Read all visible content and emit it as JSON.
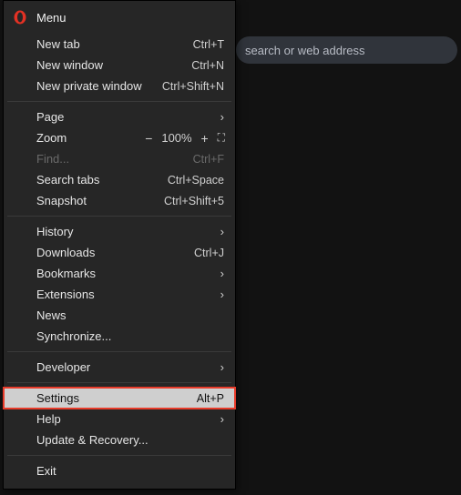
{
  "address_bar": {
    "placeholder": "search or web address"
  },
  "menu": {
    "title": "Menu",
    "groups": [
      [
        {
          "label": "New tab",
          "shortcut": "Ctrl+T"
        },
        {
          "label": "New window",
          "shortcut": "Ctrl+N"
        },
        {
          "label": "New private window",
          "shortcut": "Ctrl+Shift+N"
        }
      ],
      [
        {
          "label": "Page",
          "submenu": true
        },
        {
          "label": "Zoom",
          "zoom": true,
          "zoom_value": "100%"
        },
        {
          "label": "Find...",
          "shortcut": "Ctrl+F",
          "disabled": true
        },
        {
          "label": "Search tabs",
          "shortcut": "Ctrl+Space"
        },
        {
          "label": "Snapshot",
          "shortcut": "Ctrl+Shift+5"
        }
      ],
      [
        {
          "label": "History",
          "submenu": true
        },
        {
          "label": "Downloads",
          "shortcut": "Ctrl+J"
        },
        {
          "label": "Bookmarks",
          "submenu": true
        },
        {
          "label": "Extensions",
          "submenu": true
        },
        {
          "label": "News"
        },
        {
          "label": "Synchronize..."
        }
      ],
      [
        {
          "label": "Developer",
          "submenu": true
        }
      ],
      [
        {
          "label": "Settings",
          "shortcut": "Alt+P",
          "highlighted": true
        },
        {
          "label": "Help",
          "submenu": true
        },
        {
          "label": "Update & Recovery..."
        }
      ],
      [
        {
          "label": "Exit"
        }
      ]
    ]
  }
}
